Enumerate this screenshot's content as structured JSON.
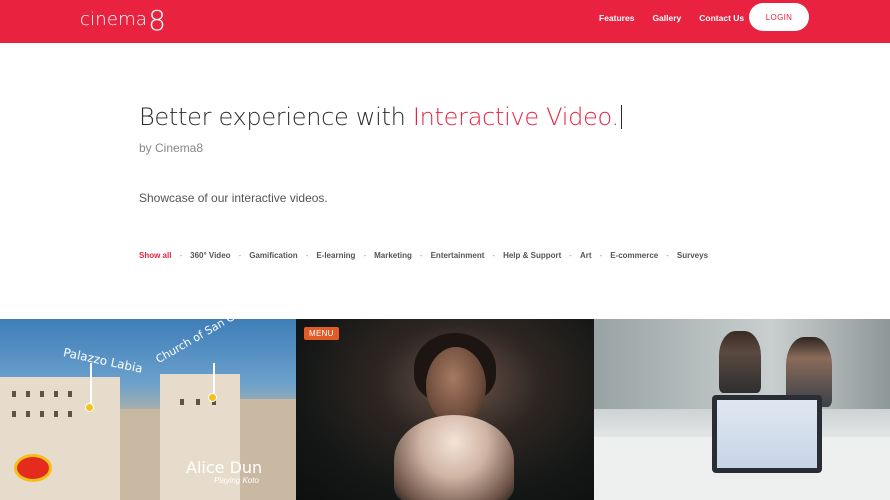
{
  "header": {
    "logo_text": "cinema",
    "logo_mark": "8",
    "nav": [
      "Features",
      "Gallery",
      "Contact Us"
    ],
    "login_label": "LOGIN"
  },
  "hero": {
    "headline_main": "Better experience with ",
    "headline_accent": "Interactive Video.",
    "byline": "by Cinema8",
    "intro": "Showcase of our interactive videos."
  },
  "filters": {
    "items": [
      "Show all",
      "360° Video",
      "Gamification",
      "E-learning",
      "Marketing",
      "Entertainment",
      "Help & Support",
      "Art",
      "E-commerce",
      "Surveys"
    ],
    "active_index": 0,
    "separator": "-"
  },
  "gallery": {
    "tile1": {
      "poi_1": "Palazzo Labia",
      "poi_2": "Church of San Geremia",
      "person_name": "Alice Dun",
      "person_subtitle": "Playing Koto"
    },
    "tile2": {
      "badge": "MENU"
    }
  },
  "colors": {
    "brand": "#e8223f",
    "badge": "#e25a25"
  }
}
